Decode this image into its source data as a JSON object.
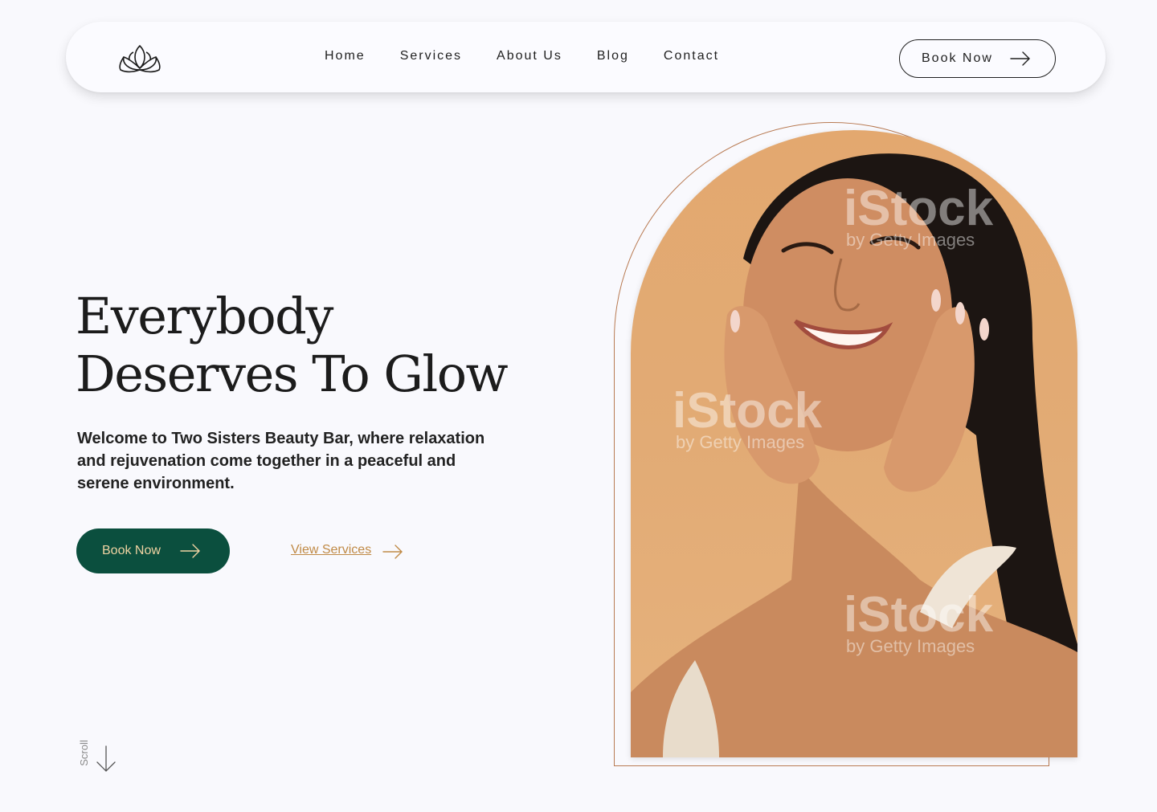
{
  "nav": {
    "links": [
      "Home",
      "Services",
      "About Us",
      "Blog",
      "Contact"
    ],
    "cta_label": "Book Now"
  },
  "hero": {
    "title_line1": "Everybody",
    "title_line2": "Deserves To Glow",
    "description": "Welcome to Two Sisters Beauty Bar, where relaxation and rejuvenation come together in a peaceful and serene environment.",
    "primary_button": "Book Now",
    "secondary_link": "View Services"
  },
  "scroll": {
    "label": "Scroll"
  },
  "image": {
    "alt": "Smiling woman touching her face",
    "watermark_brand": "iStock",
    "watermark_sub": "by Getty Images"
  },
  "colors": {
    "accent_green": "#0b4f3e",
    "accent_gold": "#c08a46",
    "arch_outline": "#b87a52",
    "photo_bg": "#e3a86f"
  },
  "icons": {
    "logo": "lotus-icon",
    "arrow": "arrow-right-icon",
    "scroll": "arrow-down-icon"
  }
}
